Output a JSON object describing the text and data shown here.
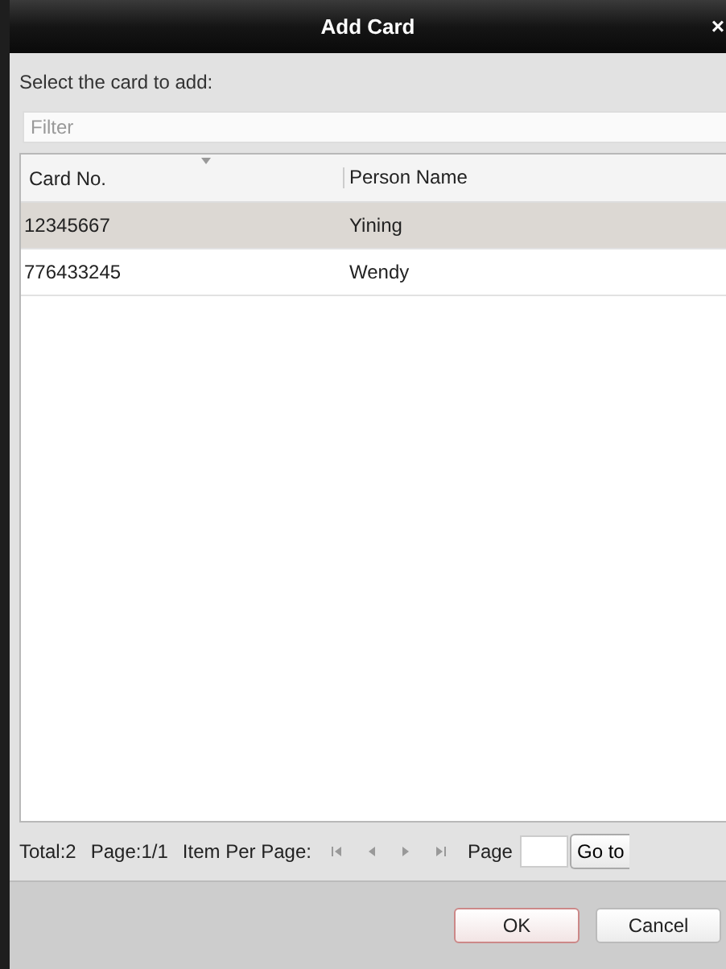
{
  "window": {
    "title": "Add Card",
    "close": "×"
  },
  "prompt": "Select the card to add:",
  "filter": {
    "placeholder": "Filter"
  },
  "table": {
    "columns": [
      "Card No.",
      "Person Name"
    ],
    "rows": [
      {
        "cells": [
          "12345667",
          "Yining"
        ],
        "selected": true
      },
      {
        "cells": [
          "776433245",
          "Wendy"
        ],
        "selected": false
      }
    ]
  },
  "pagination": {
    "total": "Total:2",
    "page": "Page:1/1",
    "per_page": "Item Per Page:",
    "page_label": "Page",
    "goto": "Go to"
  },
  "buttons": [
    {
      "label": "OK",
      "kind": "primary"
    },
    {
      "label": "Cancel",
      "kind": "normal"
    }
  ]
}
